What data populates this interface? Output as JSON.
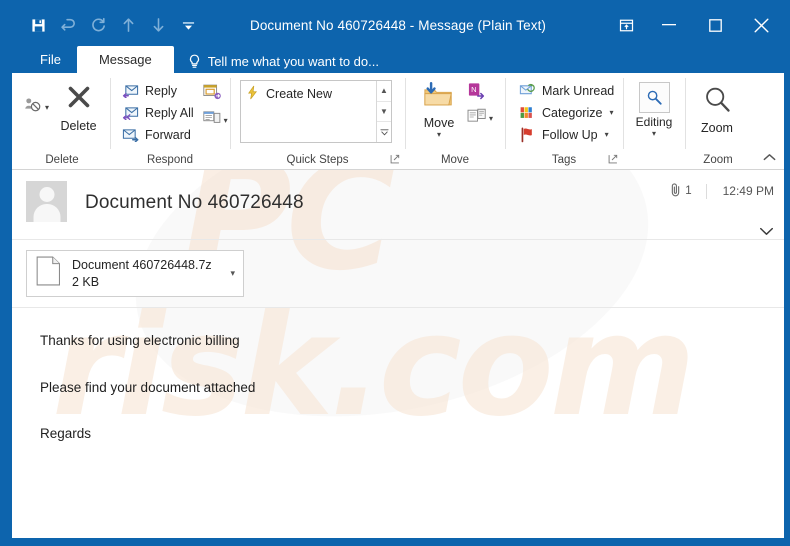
{
  "window": {
    "title": "Document No 460726448 - Message (Plain Text)",
    "accent_color": "#0d64ad",
    "quick_access": [
      {
        "name": "save-icon",
        "label": "Save",
        "state": "enabled"
      },
      {
        "name": "undo-icon",
        "label": "Undo",
        "state": "disabled"
      },
      {
        "name": "redo-icon",
        "label": "Redo",
        "state": "disabled"
      },
      {
        "name": "previous-item-icon",
        "label": "Previous Item",
        "state": "disabled"
      },
      {
        "name": "next-item-icon",
        "label": "Next Item",
        "state": "disabled"
      },
      {
        "name": "customize-quick-access-toolbar-icon",
        "label": "Customize Quick Access Toolbar",
        "state": "enabled"
      }
    ],
    "controls": {
      "ribbon_display_options": "Ribbon Display Options",
      "minimize": "Minimize",
      "maximize": "Maximize",
      "close": "Close"
    }
  },
  "tabs": {
    "file": "File",
    "message": "Message",
    "tellme": "Tell me what you want to do..."
  },
  "ribbon": {
    "collapse_label": "Collapse the Ribbon",
    "groups": [
      {
        "name": "delete",
        "label": "Delete",
        "ignore_label": "Ignore",
        "delete_label": "Delete"
      },
      {
        "name": "respond",
        "label": "Respond",
        "items": [
          {
            "label": "Reply",
            "icon": "reply-icon"
          },
          {
            "label": "Reply All",
            "icon": "reply-all-icon"
          },
          {
            "label": "Forward",
            "icon": "forward-icon"
          }
        ],
        "meeting_label": "Meeting",
        "more_label": "More Respond Actions"
      },
      {
        "name": "quick-steps",
        "label": "Quick Steps",
        "gallery_item": "Create New",
        "scroll_up": "Scroll Up",
        "scroll_down": "Scroll Down",
        "more": "More"
      },
      {
        "name": "move",
        "label": "Move",
        "move_label": "Move",
        "onenote_label": "OneNote",
        "rules_label": "Rules"
      },
      {
        "name": "tags",
        "label": "Tags",
        "items": [
          {
            "label": "Mark Unread",
            "icon": "mark-unread-icon"
          },
          {
            "label": "Categorize",
            "icon": "categorize-icon"
          },
          {
            "label": "Follow Up",
            "icon": "follow-up-flag-icon"
          }
        ],
        "category_colors": [
          "#e04a38",
          "#ef8a2b",
          "#f3c515",
          "#2f7fd1",
          "#4a9b42"
        ],
        "flag_color": "#d63d2e"
      },
      {
        "name": "editing",
        "label": "Editing",
        "button_label": "Editing"
      },
      {
        "name": "zoom",
        "label": "Zoom",
        "button_label": "Zoom"
      }
    ]
  },
  "message": {
    "subject": "Document No 460726448",
    "attachment_count": "1",
    "time": "12:49 PM",
    "attachment": {
      "filename": "Document 460726448.7z",
      "filesize": "2 KB"
    },
    "body_lines": [
      "Thanks for using electronic billing",
      "Please find your document attached",
      "Regards"
    ]
  },
  "watermark": {
    "line1": "PC",
    "line2": "risk.com"
  }
}
